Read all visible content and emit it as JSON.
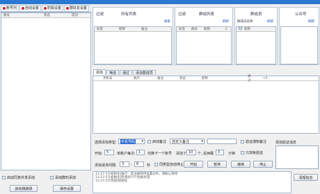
{
  "top_tabs": [
    {
      "label": "账号列"
    },
    {
      "label": "自动设置"
    },
    {
      "label": "防骰设置"
    },
    {
      "label": "群好友设置"
    }
  ],
  "left_table": {
    "headers": [
      "账号",
      "状态",
      "成功"
    ]
  },
  "left_checks": [
    "启动同意并发添加",
    "添加群时添加"
  ],
  "left_buttons": [
    "启动跳跳球",
    "保存设置"
  ],
  "panels": {
    "filter": {
      "title": "过滤",
      "list_title": "所有列表",
      "link": "搜索",
      "headers": [
        "标签",
        "昵称",
        "备注"
      ]
    },
    "group": {
      "title": "过滤",
      "list_title": "群组列表",
      "link": "刷新",
      "headers": [
        "标签",
        "群号",
        "昵称",
        "人"
      ]
    },
    "member": {
      "title": "群成员",
      "sub": "群成员名称",
      "link": "刷新",
      "headers": [
        "昵称"
      ]
    },
    "public": {
      "title": "公众号",
      "link": "刷新"
    }
  },
  "sub_tabs": [
    "添加",
    "筛选",
    "通过",
    "添加群成员"
  ],
  "main_table": {
    "headers": [
      "手机号",
      "执行",
      "备注",
      "状态",
      "昵称",
      "通过",
      "+5"
    ]
  },
  "controls": {
    "add_type_label": "选择添加类型:",
    "add_type_value": "手机号码",
    "auto_remark_label": "启动备注",
    "remark_select": "自定义备注",
    "allow_remark_label": "验证通知备注",
    "verify_label": "添加验证消息",
    "start_label": "开始:",
    "start_value": "5",
    "per_account_label": "单账户每次:",
    "per_account_value": "1",
    "switch_label": "切换下一个账号",
    "added_label": "添加了",
    "added_value": "10",
    "interval_label": "个, 后休眠",
    "interval_value": "3",
    "minutes_label": "分钟",
    "skip_label": "只加免验证",
    "delay_label": "添加请求间隔:",
    "delay_from": "3",
    "delay_to": "6",
    "seconds_label": "秒",
    "stop_label": "同类型自动停止",
    "buttons": [
      "开始",
      "暂停",
      "继续",
      "停止"
    ]
  },
  "log_lines": [
    "11:27:57[初始化]执行 - 是注册等待设置分析，请耐心等待",
    "11:27:57[初始化]检测到 0个社群/好友",
    "11:27:57[完成]初始化"
  ],
  "clear_button": "清理信息"
}
